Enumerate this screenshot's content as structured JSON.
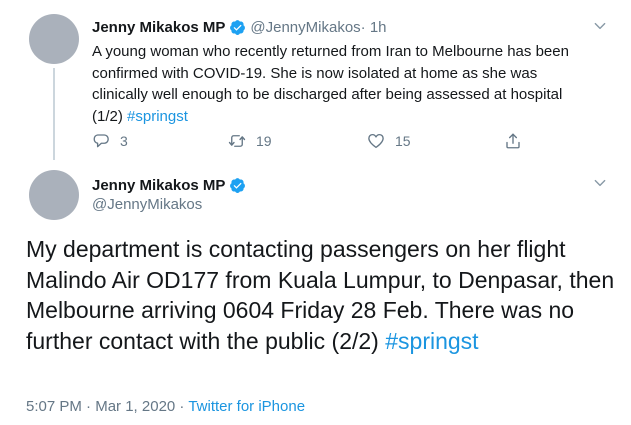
{
  "tweet1": {
    "name": "Jenny Mikakos MP",
    "handle": "@JennyMikakos",
    "time": " · 1h",
    "text": "A young woman who recently returned from Iran to Melbourne has been confirmed with COVID-19. She is now isolated at home as she was clinically well enough to be discharged after being assessed at hospital (1/2) ",
    "hashtag": "#springst",
    "replies": "3",
    "retweets": "19",
    "likes": "15"
  },
  "tweet2": {
    "name": "Jenny Mikakos MP",
    "handle": "@JennyMikakos",
    "text": "My department is contacting passengers on her flight Malindo Air OD177 from Kuala Lumpur, to Denpasar, then Melbourne arriving 0604 Friday 28 Feb. There was no further contact with the public (2/2) ",
    "hashtag": "#springst",
    "time": "5:07 PM",
    "date": "Mar 1, 2020",
    "separator": " · ",
    "source": "Twitter for iPhone"
  },
  "colors": {
    "accent": "#1da1f2",
    "link": "#1b95e0",
    "muted": "#657786",
    "text": "#14171a"
  },
  "icons": [
    "verified-badge-icon",
    "chevron-down-icon",
    "reply-icon",
    "retweet-icon",
    "like-icon",
    "share-icon"
  ]
}
